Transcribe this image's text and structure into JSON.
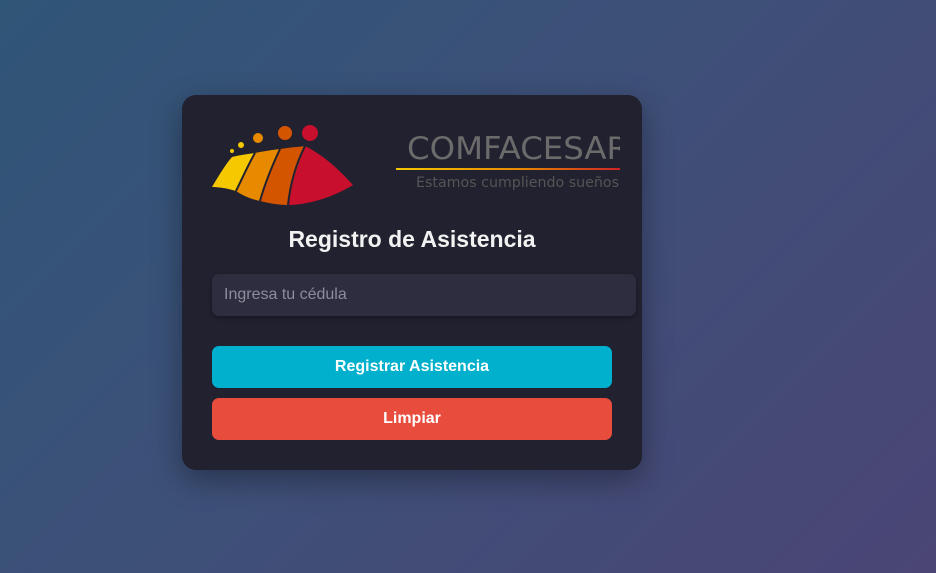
{
  "logo": {
    "brand_name": "COMFACESAR",
    "slogan": "Estamos cumpliendo sueños",
    "colors": [
      "#f5c800",
      "#e88a00",
      "#d45500",
      "#c8102e"
    ]
  },
  "form": {
    "title": "Registro de Asistencia",
    "cedula_placeholder": "Ingresa tu cédula",
    "cedula_value": "",
    "register_label": "Registrar Asistencia",
    "clear_label": "Limpiar"
  },
  "colors": {
    "card_bg": "#21212f",
    "input_bg": "#2e2d3f",
    "primary": "#00b0cc",
    "danger": "#e74c3c"
  }
}
